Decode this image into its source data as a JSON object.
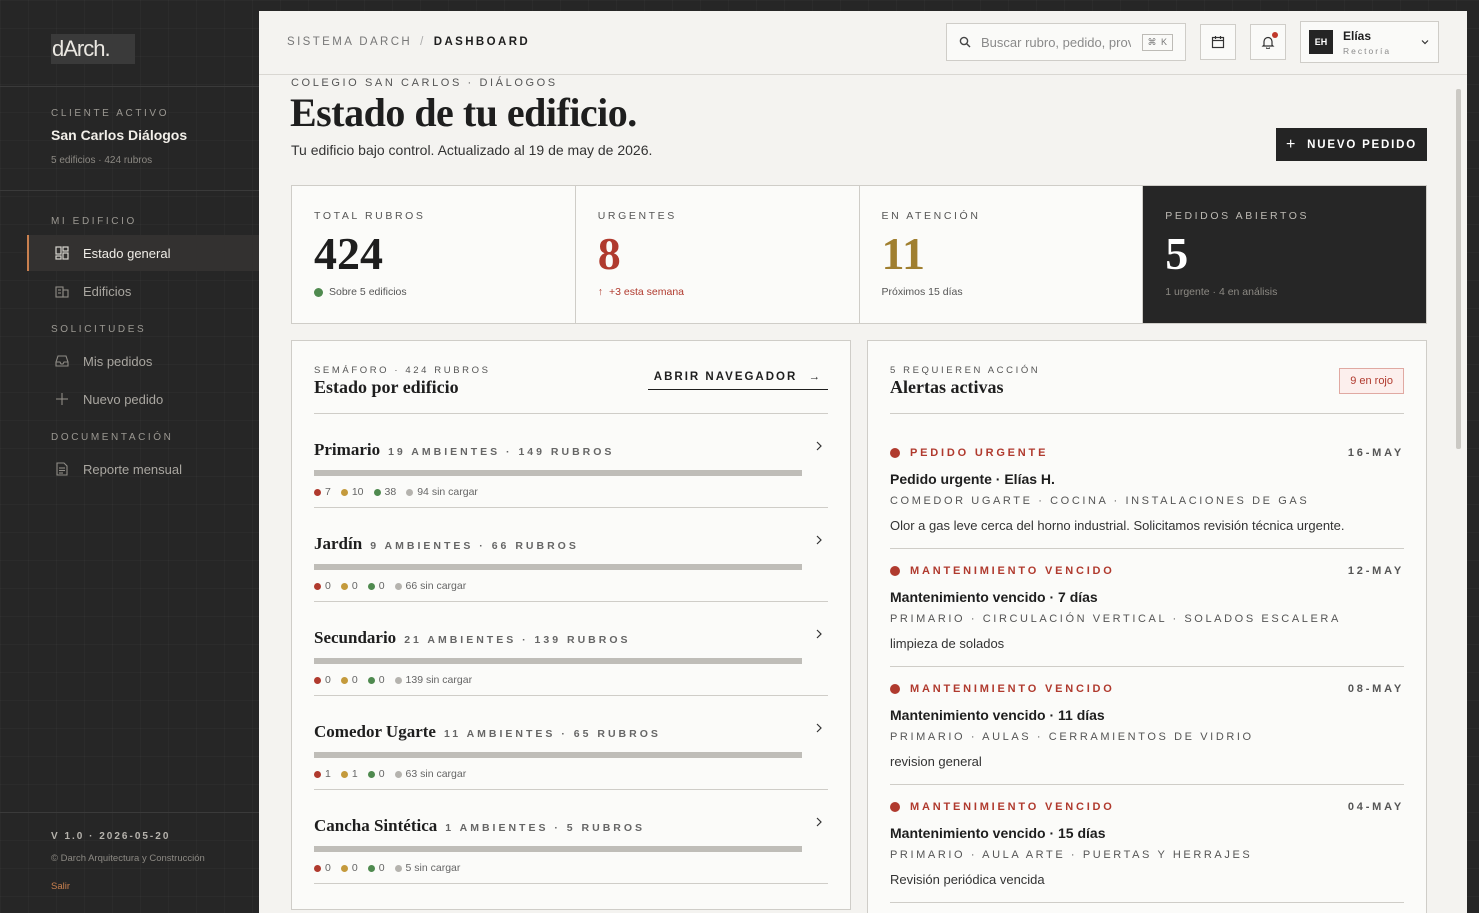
{
  "sidebar": {
    "logo": "dArch.",
    "client_label": "Cliente activo",
    "client_name": "San Carlos Diálogos",
    "client_meta": "5 edificios · 424 rubros",
    "sections": [
      {
        "label": "Mi edificio"
      },
      {
        "label": "Solicitudes"
      },
      {
        "label": "Documentación"
      }
    ],
    "items": [
      {
        "label": "Estado general",
        "icon": "dashboard-icon",
        "active": true
      },
      {
        "label": "Edificios",
        "icon": "building-icon"
      },
      {
        "label": "Mis pedidos",
        "icon": "inbox-icon"
      },
      {
        "label": "Nuevo pedido",
        "icon": "plus-icon"
      },
      {
        "label": "Reporte mensual",
        "icon": "document-icon"
      }
    ],
    "version": "V 1.0 · 2026-05-20",
    "copyright": "© Darch Arquitectura y Construcción",
    "logout": "Salir"
  },
  "topbar": {
    "breadcrumb_root": "Sistema Darch",
    "breadcrumb_sep": "/",
    "breadcrumb_current": "Dashboard",
    "search_placeholder": "Buscar rubro, pedido, proveedor",
    "search_kbd": "⌘ K",
    "user_initials": "EH",
    "user_name": "Elías",
    "user_role": "Rectoría"
  },
  "header": {
    "kicker": "Colegio San Carlos · Diálogos",
    "title": "Estado de tu edificio.",
    "subtitle": "Tu edificio bajo control. Actualizado al 19 de may de 2026.",
    "new_button": "Nuevo pedido"
  },
  "kpis": [
    {
      "label": "Total rubros",
      "value": "424",
      "foot": "Sobre 5 edificios",
      "color": "#1e1e1e",
      "dot": "#4f8a4f"
    },
    {
      "label": "Urgentes",
      "value": "8",
      "foot": "+3 esta semana",
      "color": "#b03a2e",
      "arrow": "↑"
    },
    {
      "label": "En atención",
      "value": "11",
      "foot": "Próximos 15 días",
      "color": "#a07f2f"
    },
    {
      "label": "Pedidos abiertos",
      "value": "5",
      "foot": "1 urgente · 4 en análisis",
      "color": "#ffffff"
    }
  ],
  "buildings_panel": {
    "kicker": "Semáforo · 424 rubros",
    "title": "Estado por edificio",
    "link": "Abrir navegador",
    "link_arrow": "→",
    "buildings": [
      {
        "name": "Primario",
        "meta": "19 ambientes · 149 rubros",
        "red": "7",
        "yellow": "10",
        "green": "38",
        "empty": "94 sin cargar"
      },
      {
        "name": "Jardín",
        "meta": "9 ambientes · 66 rubros",
        "red": "0",
        "yellow": "0",
        "green": "0",
        "empty": "66 sin cargar"
      },
      {
        "name": "Secundario",
        "meta": "21 ambientes · 139 rubros",
        "red": "0",
        "yellow": "0",
        "green": "0",
        "empty": "139 sin cargar"
      },
      {
        "name": "Comedor Ugarte",
        "meta": "11 ambientes · 65 rubros",
        "red": "1",
        "yellow": "1",
        "green": "0",
        "empty": "63 sin cargar"
      },
      {
        "name": "Cancha Sintética",
        "meta": "1 ambientes · 5 rubros",
        "red": "0",
        "yellow": "0",
        "green": "0",
        "empty": "5 sin cargar"
      }
    ]
  },
  "alerts_panel": {
    "kicker": "5 requieren acción",
    "title": "Alertas activas",
    "badge": "9 en rojo",
    "alerts": [
      {
        "type": "Pedido urgente",
        "date": "16-May",
        "title": "Pedido urgente · Elías H.",
        "location": "Comedor Ugarte · Cocina · Instalaciones de gas",
        "desc": "Olor a gas leve cerca del horno industrial. Solicitamos revisión técnica urgente."
      },
      {
        "type": "Mantenimiento vencido",
        "date": "12-May",
        "title": "Mantenimiento vencido · 7 días",
        "location": "Primario · Circulación vertical · Solados escalera",
        "desc": "limpieza de solados"
      },
      {
        "type": "Mantenimiento vencido",
        "date": "08-May",
        "title": "Mantenimiento vencido · 11 días",
        "location": "Primario · Aulas · Cerramientos de vidrio",
        "desc": "revision general"
      },
      {
        "type": "Mantenimiento vencido",
        "date": "04-May",
        "title": "Mantenimiento vencido · 15 días",
        "location": "Primario · Aula arte · Puertas y herrajes",
        "desc": "Revisión periódica vencida"
      }
    ]
  },
  "colors": {
    "red": "#b03a2e",
    "yellow": "#c49a3c",
    "green": "#4f8a4f",
    "grey": "#b5b3ae",
    "accent": "#c9804f"
  }
}
